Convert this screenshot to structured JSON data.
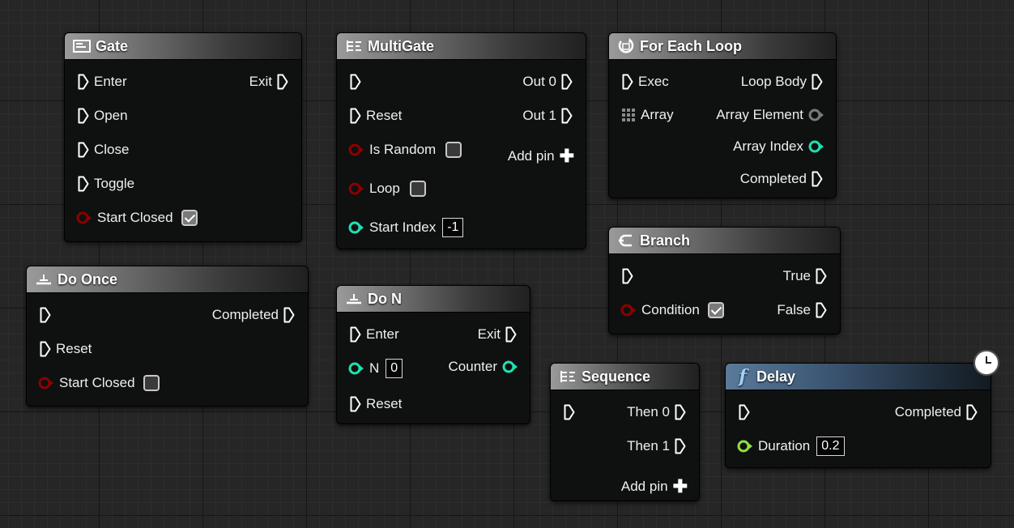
{
  "nodes": {
    "gate": {
      "title": "Gate",
      "pins": {
        "enter": "Enter",
        "exit": "Exit",
        "open": "Open",
        "close": "Close",
        "toggle": "Toggle",
        "start_closed": "Start Closed"
      },
      "start_closed_checked": true
    },
    "multigate": {
      "title": "MultiGate",
      "pins": {
        "out0": "Out 0",
        "reset": "Reset",
        "out1": "Out 1",
        "is_random": "Is Random",
        "add_pin": "Add pin",
        "loop": "Loop",
        "start_index": "Start Index"
      },
      "start_index_value": "-1",
      "is_random_checked": false,
      "loop_checked": false
    },
    "foreach": {
      "title": "For Each Loop",
      "pins": {
        "exec": "Exec",
        "loop_body": "Loop Body",
        "array": "Array",
        "array_element": "Array Element",
        "array_index": "Array Index",
        "completed": "Completed"
      }
    },
    "branch": {
      "title": "Branch",
      "pins": {
        "true": "True",
        "condition": "Condition",
        "false": "False"
      },
      "condition_checked": true
    },
    "doonce": {
      "title": "Do Once",
      "pins": {
        "completed": "Completed",
        "reset": "Reset",
        "start_closed": "Start Closed"
      },
      "start_closed_checked": false
    },
    "don": {
      "title": "Do N",
      "pins": {
        "enter": "Enter",
        "exit": "Exit",
        "n": "N",
        "counter": "Counter",
        "reset": "Reset"
      },
      "n_value": "0"
    },
    "sequence": {
      "title": "Sequence",
      "pins": {
        "then0": "Then 0",
        "then1": "Then 1",
        "add_pin": "Add pin"
      }
    },
    "delay": {
      "title": "Delay",
      "pins": {
        "completed": "Completed",
        "duration": "Duration"
      },
      "duration_value": "0.2"
    }
  },
  "colors": {
    "exec_pin": "#ffffff",
    "bool_pin": "#8c0000",
    "int_pin": "#1fe0b0",
    "float_pin": "#90e040",
    "wildcard_pin": "#7a7a7a",
    "graph_bg": "#262626"
  },
  "icons": {
    "gate": "gate-icon",
    "multigate": "multigate-icon",
    "foreach": "loop-icon",
    "branch": "branch-icon",
    "doonce": "do-once-icon",
    "don": "do-n-icon",
    "sequence": "sequence-icon",
    "delay": "function-icon",
    "latent": "clock-icon"
  }
}
